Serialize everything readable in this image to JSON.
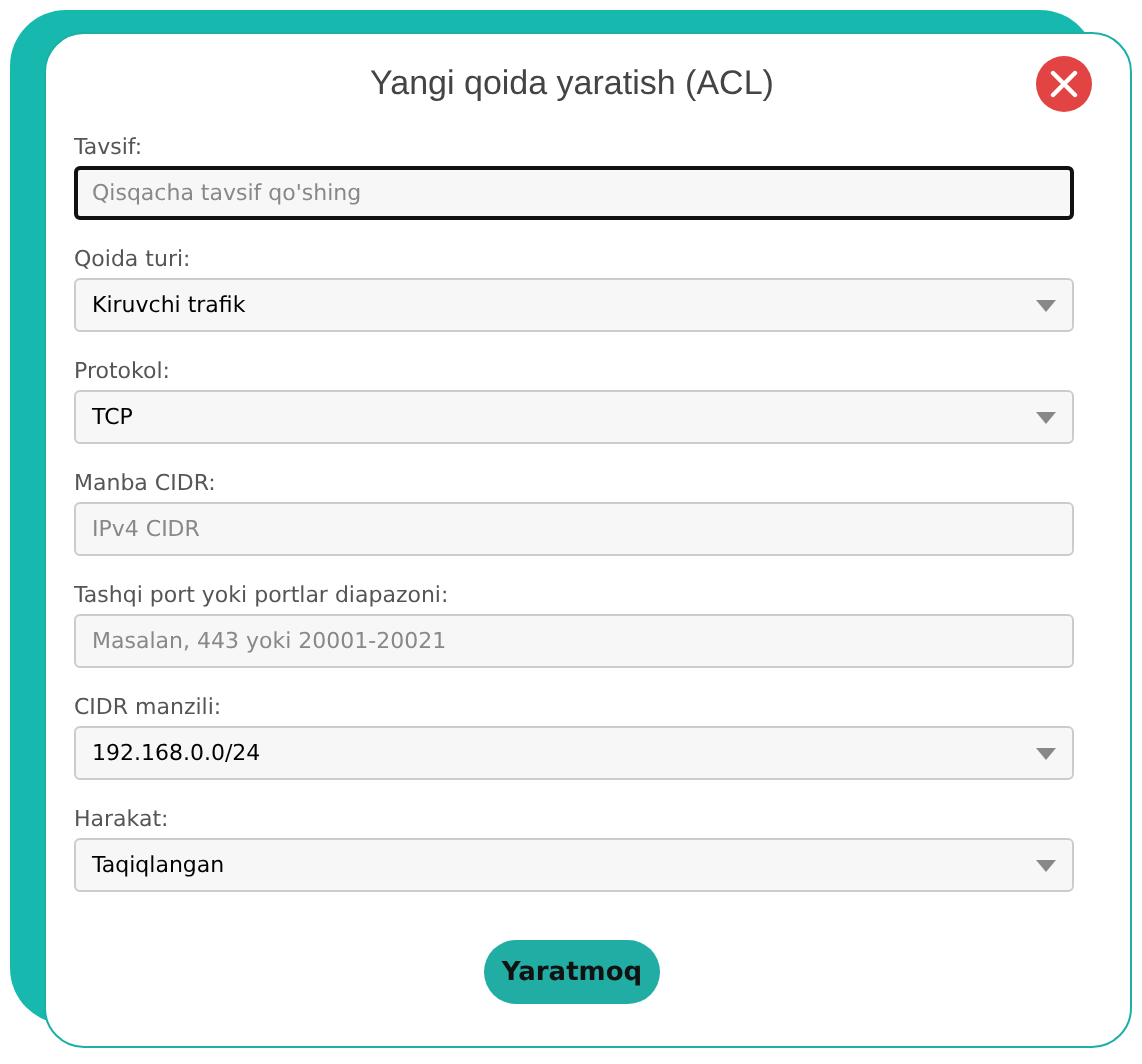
{
  "dialog": {
    "title": "Yangi qoida yaratish (ACL)"
  },
  "fields": [
    {
      "label": "Tavsif:",
      "kind": "text",
      "placeholder": "Qisqacha tavsif qo'shing",
      "focused": true
    },
    {
      "label": "Qoida turi:",
      "kind": "select",
      "value": "Kiruvchi trafik",
      "focused": false
    },
    {
      "label": "Protokol:",
      "kind": "select",
      "value": "TCP",
      "focused": false
    },
    {
      "label": "Manba CIDR:",
      "kind": "text",
      "placeholder": "IPv4 CIDR",
      "focused": false
    },
    {
      "label": "Tashqi port yoki portlar diapazoni:",
      "kind": "text",
      "placeholder": "Masalan, 443 yoki 20001-20021",
      "focused": false
    },
    {
      "label": "CIDR manzili:",
      "kind": "select",
      "value": "192.168.0.0/24",
      "focused": false
    },
    {
      "label": "Harakat:",
      "kind": "select",
      "value": "Taqiqlangan",
      "focused": false
    }
  ],
  "submit": "Yaratmoq"
}
